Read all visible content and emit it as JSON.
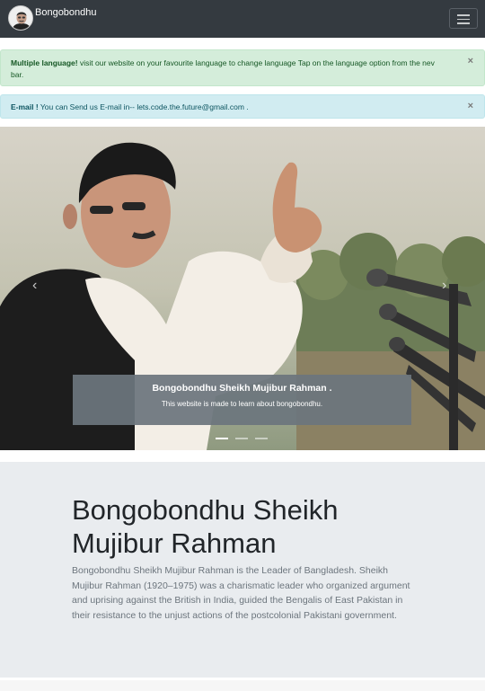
{
  "navbar": {
    "brand": "Bongobondhu",
    "toggler_icon": "hamburger-menu-icon",
    "background": "#343a40"
  },
  "alerts": {
    "language": {
      "strong": "Multiple language!",
      "text": " visit our website on your favourite language to change language Tap on the language option from the nev bar.",
      "close": "×"
    },
    "email": {
      "strong": "E-mail !",
      "text": " You can Send us E-mail in-- lets.code.the.future@gmail.com .",
      "close": "×"
    }
  },
  "carousel": {
    "caption_title": "Bongobondhu Sheikh Mujibur Rahman .",
    "caption_text": "This website is made to learn about bongobondhu.",
    "prev_icon": "‹",
    "next_icon": "›",
    "active_slide": 1,
    "slide_count": 3
  },
  "jumbotron": {
    "title": "Bongobondhu Sheikh Mujibur Rahman",
    "text": "Bongobondhu Sheikh Mujibur Rahman is the Leader of Bangladesh. Sheikh Mujibur Rahman (1920–1975) was a charismatic leader who organized argument and uprising against the British in India, guided the Bengalis of East Pakistan in their resistance to the unjust actions of the postcolonial Pakistani government."
  }
}
